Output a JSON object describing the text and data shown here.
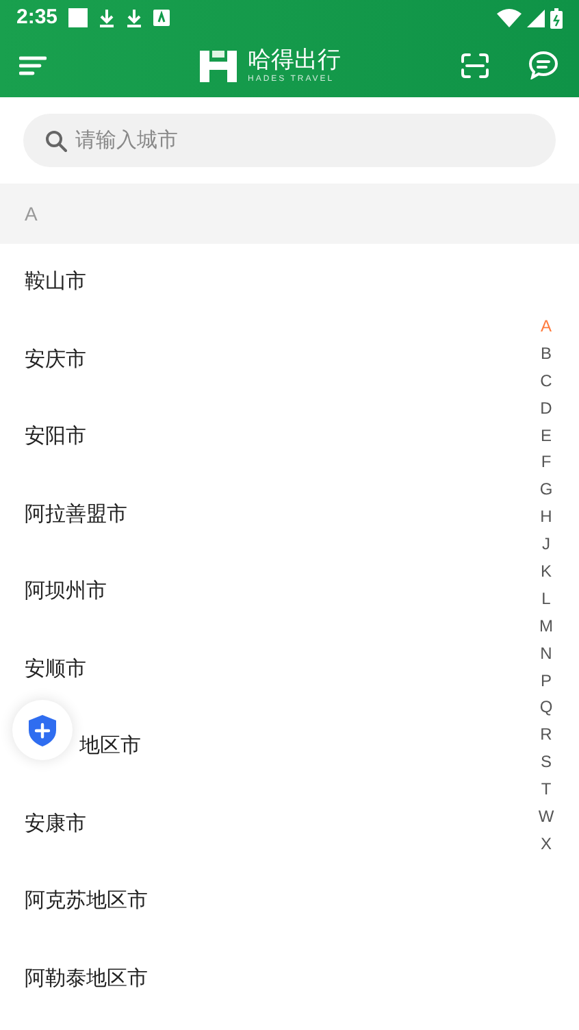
{
  "status_bar": {
    "time": "2:35"
  },
  "app_bar": {
    "brand_name": "哈得出行",
    "brand_subtitle": "HADES TRAVEL"
  },
  "search": {
    "placeholder": "请输入城市"
  },
  "section": {
    "header": "A"
  },
  "cities": [
    {
      "name": "鞍山市",
      "covered": false
    },
    {
      "name": "安庆市",
      "covered": false
    },
    {
      "name": "安阳市",
      "covered": false
    },
    {
      "name": "阿拉善盟市",
      "covered": false
    },
    {
      "name": "阿坝州市",
      "covered": false
    },
    {
      "name": "安顺市",
      "covered": false
    },
    {
      "name": "地区市",
      "covered": true
    },
    {
      "name": "安康市",
      "covered": false
    },
    {
      "name": "阿克苏地区市",
      "covered": false
    },
    {
      "name": "阿勒泰地区市",
      "covered": false
    }
  ],
  "index": [
    {
      "letter": "A",
      "selected": true
    },
    {
      "letter": "B",
      "selected": false
    },
    {
      "letter": "C",
      "selected": false
    },
    {
      "letter": "D",
      "selected": false
    },
    {
      "letter": "E",
      "selected": false
    },
    {
      "letter": "F",
      "selected": false
    },
    {
      "letter": "G",
      "selected": false
    },
    {
      "letter": "H",
      "selected": false
    },
    {
      "letter": "J",
      "selected": false
    },
    {
      "letter": "K",
      "selected": false
    },
    {
      "letter": "L",
      "selected": false
    },
    {
      "letter": "M",
      "selected": false
    },
    {
      "letter": "N",
      "selected": false
    },
    {
      "letter": "P",
      "selected": false
    },
    {
      "letter": "Q",
      "selected": false
    },
    {
      "letter": "R",
      "selected": false
    },
    {
      "letter": "S",
      "selected": false
    },
    {
      "letter": "T",
      "selected": false
    },
    {
      "letter": "W",
      "selected": false
    },
    {
      "letter": "X",
      "selected": false
    }
  ]
}
